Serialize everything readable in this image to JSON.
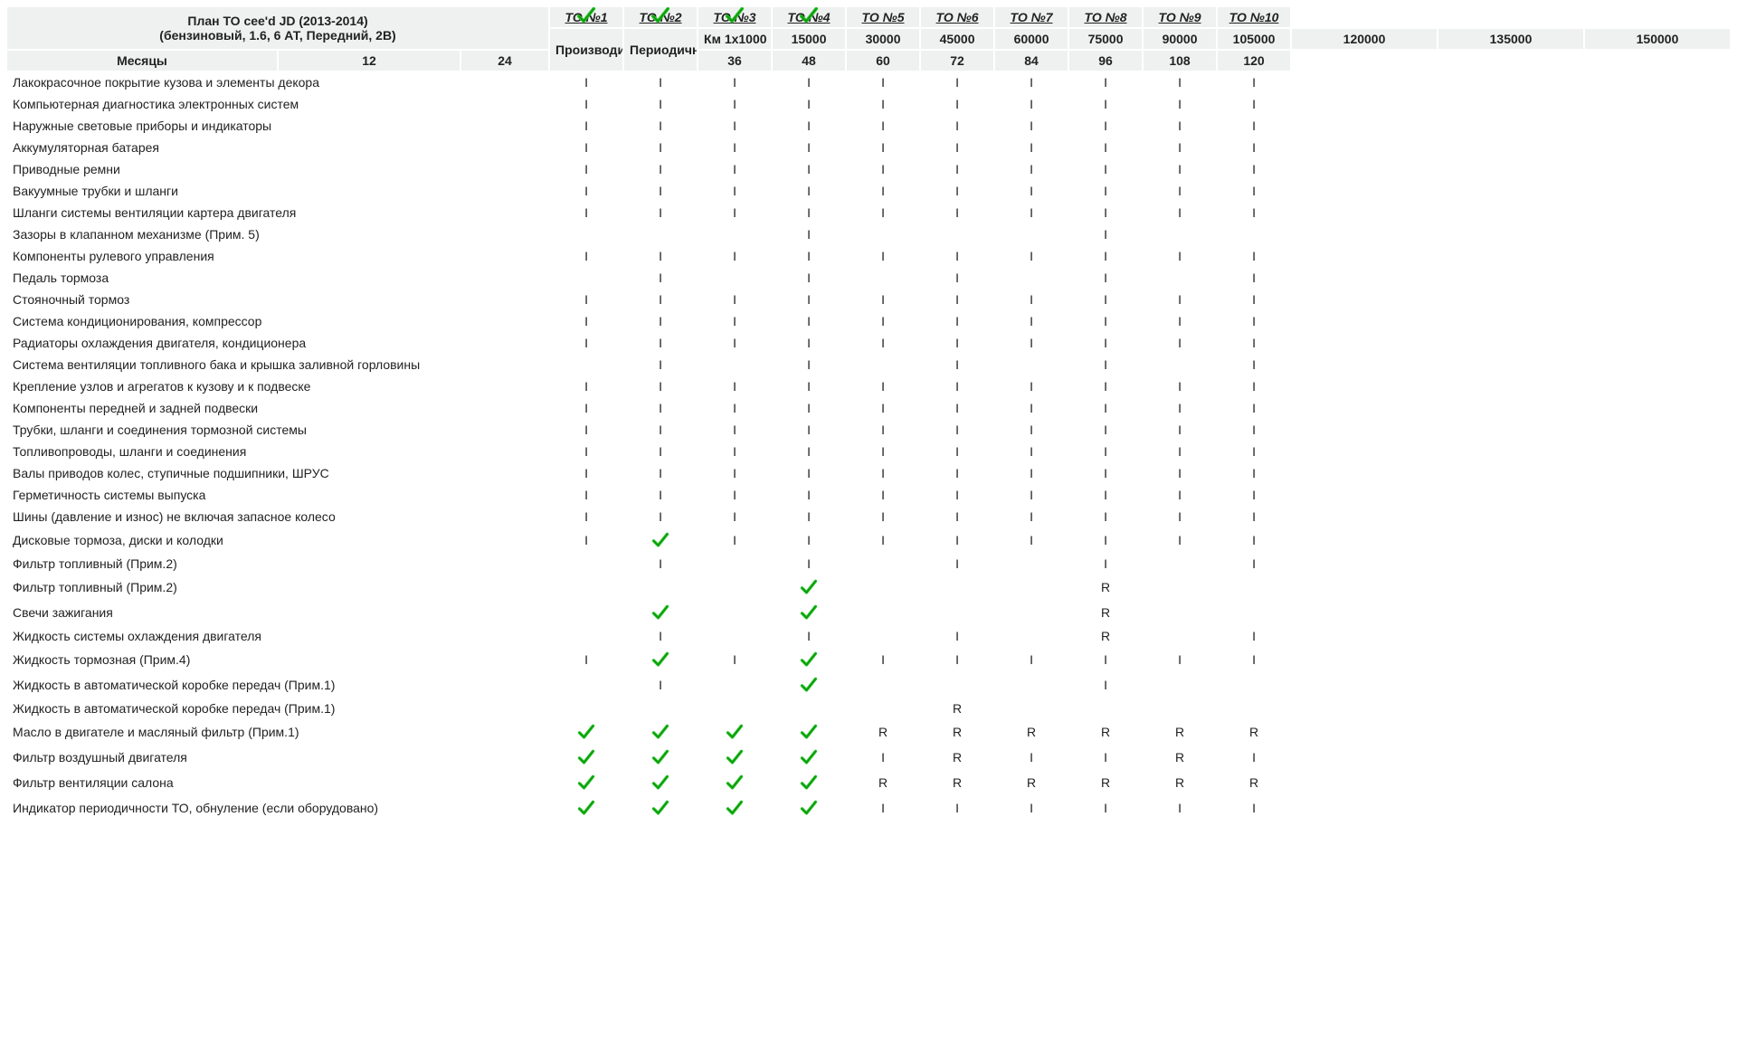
{
  "title": {
    "line1": "План ТО cee'd JD (2013-2014)",
    "line2": "(бензиновый, 1.6, 6 АТ, Передний, 2В)"
  },
  "headers": {
    "works": "Производимые работы",
    "periodicity": "Периодичность",
    "km_label": "Км 1х1000",
    "months_label": "Месяцы"
  },
  "to_columns": [
    {
      "label": "ТО №1",
      "completed": true,
      "km": "15000",
      "months": "12"
    },
    {
      "label": "ТО №2",
      "completed": true,
      "km": "30000",
      "months": "24"
    },
    {
      "label": "ТО №3",
      "completed": true,
      "km": "45000",
      "months": "36"
    },
    {
      "label": "ТО №4",
      "completed": true,
      "km": "60000",
      "months": "48"
    },
    {
      "label": "ТО №5",
      "completed": false,
      "km": "75000",
      "months": "60"
    },
    {
      "label": "ТО №6",
      "completed": false,
      "km": "90000",
      "months": "72"
    },
    {
      "label": "ТО №7",
      "completed": false,
      "km": "105000",
      "months": "84"
    },
    {
      "label": "ТО №8",
      "completed": false,
      "km": "120000",
      "months": "96"
    },
    {
      "label": "ТО №9",
      "completed": false,
      "km": "135000",
      "months": "108"
    },
    {
      "label": "ТО №10",
      "completed": false,
      "km": "150000",
      "months": "120"
    }
  ],
  "rows": [
    {
      "name": "Лакокрасочное покрытие кузова и элементы декора",
      "cells": [
        "I",
        "I",
        "I",
        "I",
        "I",
        "I",
        "I",
        "I",
        "I",
        "I"
      ]
    },
    {
      "name": "Компьютерная диагностика электронных систем",
      "cells": [
        "I",
        "I",
        "I",
        "I",
        "I",
        "I",
        "I",
        "I",
        "I",
        "I"
      ]
    },
    {
      "name": "Наружные световые приборы и индикаторы",
      "cells": [
        "I",
        "I",
        "I",
        "I",
        "I",
        "I",
        "I",
        "I",
        "I",
        "I"
      ]
    },
    {
      "name": "Аккумуляторная батарея",
      "cells": [
        "I",
        "I",
        "I",
        "I",
        "I",
        "I",
        "I",
        "I",
        "I",
        "I"
      ]
    },
    {
      "name": "Приводные ремни",
      "cells": [
        "I",
        "I",
        "I",
        "I",
        "I",
        "I",
        "I",
        "I",
        "I",
        "I"
      ]
    },
    {
      "name": "Вакуумные трубки и шланги",
      "cells": [
        "I",
        "I",
        "I",
        "I",
        "I",
        "I",
        "I",
        "I",
        "I",
        "I"
      ]
    },
    {
      "name": "Шланги системы вентиляции картера двигателя",
      "cells": [
        "I",
        "I",
        "I",
        "I",
        "I",
        "I",
        "I",
        "I",
        "I",
        "I"
      ]
    },
    {
      "name": "Зазоры в клапанном механизме (Прим. 5)",
      "cells": [
        "",
        "",
        "",
        "I",
        "",
        "",
        "",
        "I",
        "",
        ""
      ]
    },
    {
      "name": "Компоненты рулевого управления",
      "cells": [
        "I",
        "I",
        "I",
        "I",
        "I",
        "I",
        "I",
        "I",
        "I",
        "I"
      ]
    },
    {
      "name": "Педаль тормоза",
      "cells": [
        "",
        "I",
        "",
        "I",
        "",
        "I",
        "",
        "I",
        "",
        "I"
      ]
    },
    {
      "name": "Стояночный тормоз",
      "cells": [
        "I",
        "I",
        "I",
        "I",
        "I",
        "I",
        "I",
        "I",
        "I",
        "I"
      ]
    },
    {
      "name": "Система кондиционирования, компрессор",
      "cells": [
        "I",
        "I",
        "I",
        "I",
        "I",
        "I",
        "I",
        "I",
        "I",
        "I"
      ]
    },
    {
      "name": "Радиаторы охлаждения двигателя, кондиционера",
      "cells": [
        "I",
        "I",
        "I",
        "I",
        "I",
        "I",
        "I",
        "I",
        "I",
        "I"
      ]
    },
    {
      "name": "Система вентиляции топливного бака и крышка заливной горловины",
      "cells": [
        "",
        "I",
        "",
        "I",
        "",
        "I",
        "",
        "I",
        "",
        "I"
      ]
    },
    {
      "name": "Крепление узлов и агрегатов к кузову и к подвеске",
      "cells": [
        "I",
        "I",
        "I",
        "I",
        "I",
        "I",
        "I",
        "I",
        "I",
        "I"
      ]
    },
    {
      "name": "Компоненты передней и задней подвески",
      "cells": [
        "I",
        "I",
        "I",
        "I",
        "I",
        "I",
        "I",
        "I",
        "I",
        "I"
      ]
    },
    {
      "name": "Трубки, шланги и соединения тормозной системы",
      "cells": [
        "I",
        "I",
        "I",
        "I",
        "I",
        "I",
        "I",
        "I",
        "I",
        "I"
      ]
    },
    {
      "name": "Топливопроводы, шланги и соединения",
      "cells": [
        "I",
        "I",
        "I",
        "I",
        "I",
        "I",
        "I",
        "I",
        "I",
        "I"
      ]
    },
    {
      "name": "Валы приводов колес, ступичные подшипники, ШРУС",
      "cells": [
        "I",
        "I",
        "I",
        "I",
        "I",
        "I",
        "I",
        "I",
        "I",
        "I"
      ]
    },
    {
      "name": "Герметичность системы выпуска",
      "cells": [
        "I",
        "I",
        "I",
        "I",
        "I",
        "I",
        "I",
        "I",
        "I",
        "I"
      ]
    },
    {
      "name": "Шины (давление и износ) не включая запасное колесо",
      "cells": [
        "I",
        "I",
        "I",
        "I",
        "I",
        "I",
        "I",
        "I",
        "I",
        "I"
      ]
    },
    {
      "name": "Дисковые тормоза, диски и колодки",
      "cells": [
        "I",
        "CHECK",
        "I",
        "I",
        "I",
        "I",
        "I",
        "I",
        "I",
        "I"
      ]
    },
    {
      "name": "Фильтр топливный (Прим.2)",
      "cells": [
        "",
        "I",
        "",
        "I",
        "",
        "I",
        "",
        "I",
        "",
        "I"
      ]
    },
    {
      "name": "Фильтр топливный (Прим.2)",
      "cells": [
        "",
        "",
        "",
        "CHECK",
        "",
        "",
        "",
        "R",
        "",
        ""
      ]
    },
    {
      "name": "Свечи зажигания",
      "cells": [
        "",
        "CHECK",
        "",
        "CHECK",
        "",
        "",
        "",
        "R",
        "",
        ""
      ]
    },
    {
      "name": "Жидкость системы охлаждения двигателя",
      "cells": [
        "",
        "I",
        "",
        "I",
        "",
        "I",
        "",
        "R",
        "",
        "I"
      ]
    },
    {
      "name": "Жидкость тормозная (Прим.4)",
      "cells": [
        "I",
        "CHECK",
        "I",
        "CHECK",
        "I",
        "I",
        "I",
        "I",
        "I",
        "I"
      ]
    },
    {
      "name": "Жидкость в автоматической коробке передач (Прим.1)",
      "cells": [
        "",
        "I",
        "",
        "CHECK",
        "",
        "",
        "",
        "I",
        "",
        ""
      ]
    },
    {
      "name": "Жидкость в автоматической коробке передач (Прим.1)",
      "cells": [
        "",
        "",
        "",
        "",
        "",
        "R",
        "",
        "",
        "",
        ""
      ]
    },
    {
      "name": "Масло в двигателе и масляный фильтр (Прим.1)",
      "cells": [
        "CHECK",
        "CHECK",
        "CHECK",
        "CHECK",
        "R",
        "R",
        "R",
        "R",
        "R",
        "R"
      ]
    },
    {
      "name": "Фильтр воздушный двигателя",
      "cells": [
        "CHECK",
        "CHECK",
        "CHECK",
        "CHECK",
        "I",
        "R",
        "I",
        "I",
        "R",
        "I"
      ]
    },
    {
      "name": "Фильтр вентиляции салона",
      "cells": [
        "CHECK",
        "CHECK",
        "CHECK",
        "CHECK",
        "R",
        "R",
        "R",
        "R",
        "R",
        "R"
      ]
    },
    {
      "name": "Индикатор периодичности ТО, обнуление (если оборудовано)",
      "cells": [
        "CHECK",
        "CHECK",
        "CHECK",
        "CHECK",
        "I",
        "I",
        "I",
        "I",
        "I",
        "I"
      ]
    }
  ]
}
